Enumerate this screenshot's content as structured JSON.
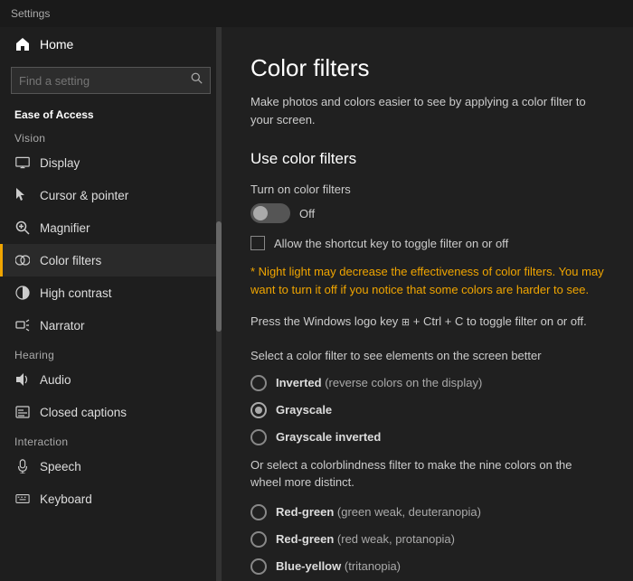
{
  "titleBar": {
    "label": "Settings"
  },
  "sidebar": {
    "homeLabel": "Home",
    "searchPlaceholder": "Find a setting",
    "easeOfAccessLabel": "Ease of Access",
    "categories": {
      "vision": "Vision",
      "hearing": "Hearing",
      "interaction": "Interaction"
    },
    "items": [
      {
        "id": "display",
        "label": "Display",
        "icon": "🖥"
      },
      {
        "id": "cursor-pointer",
        "label": "Cursor & pointer",
        "icon": "👆"
      },
      {
        "id": "magnifier",
        "label": "Magnifier",
        "icon": "🔍"
      },
      {
        "id": "color-filters",
        "label": "Color filters",
        "icon": "🎨",
        "active": true
      },
      {
        "id": "high-contrast",
        "label": "High contrast",
        "icon": "◑"
      },
      {
        "id": "narrator",
        "label": "Narrator",
        "icon": "💬"
      },
      {
        "id": "audio",
        "label": "Audio",
        "icon": "🔊"
      },
      {
        "id": "closed-captions",
        "label": "Closed captions",
        "icon": "📝"
      },
      {
        "id": "speech",
        "label": "Speech",
        "icon": "🎤"
      },
      {
        "id": "keyboard",
        "label": "Keyboard",
        "icon": "⌨"
      }
    ]
  },
  "mainContent": {
    "pageTitle": "Color filters",
    "pageDescription": "Make photos and colors easier to see by applying a color filter to your screen.",
    "sectionTitle": "Use color filters",
    "turnOnLabel": "Turn on color filters",
    "toggleState": "Off",
    "checkboxLabel": "Allow the shortcut key to toggle filter on or off",
    "nightLightNotice": {
      "prefix": "* ",
      "link": "Night light",
      "suffix": " may decrease the effectiveness of color filters. You may want to turn it off if you notice that some colors are harder to see."
    },
    "shortcutNote": "Press the Windows logo key  + Ctrl + C to toggle filter on or off.",
    "filterSelectLabel": "Select a color filter to see elements on the screen better",
    "filters": [
      {
        "id": "inverted",
        "label": "Inverted",
        "desc": "(reverse colors on the display)",
        "selected": false
      },
      {
        "id": "grayscale",
        "label": "Grayscale",
        "desc": "",
        "selected": true
      },
      {
        "id": "grayscale-inverted",
        "label": "Grayscale inverted",
        "desc": "",
        "selected": false
      }
    ],
    "colorblindLabel": "Or select a colorblindness filter to make the nine colors on the wheel more distinct.",
    "colorblindFilters": [
      {
        "id": "red-green-weak",
        "label": "Red-green",
        "desc": "(green weak, deuteranopia)",
        "selected": false
      },
      {
        "id": "red-green-strong",
        "label": "Red-green",
        "desc": "(red weak, protanopia)",
        "selected": false
      },
      {
        "id": "blue-yellow",
        "label": "Blue-yellow",
        "desc": "(tritanopia)",
        "selected": false
      }
    ]
  }
}
